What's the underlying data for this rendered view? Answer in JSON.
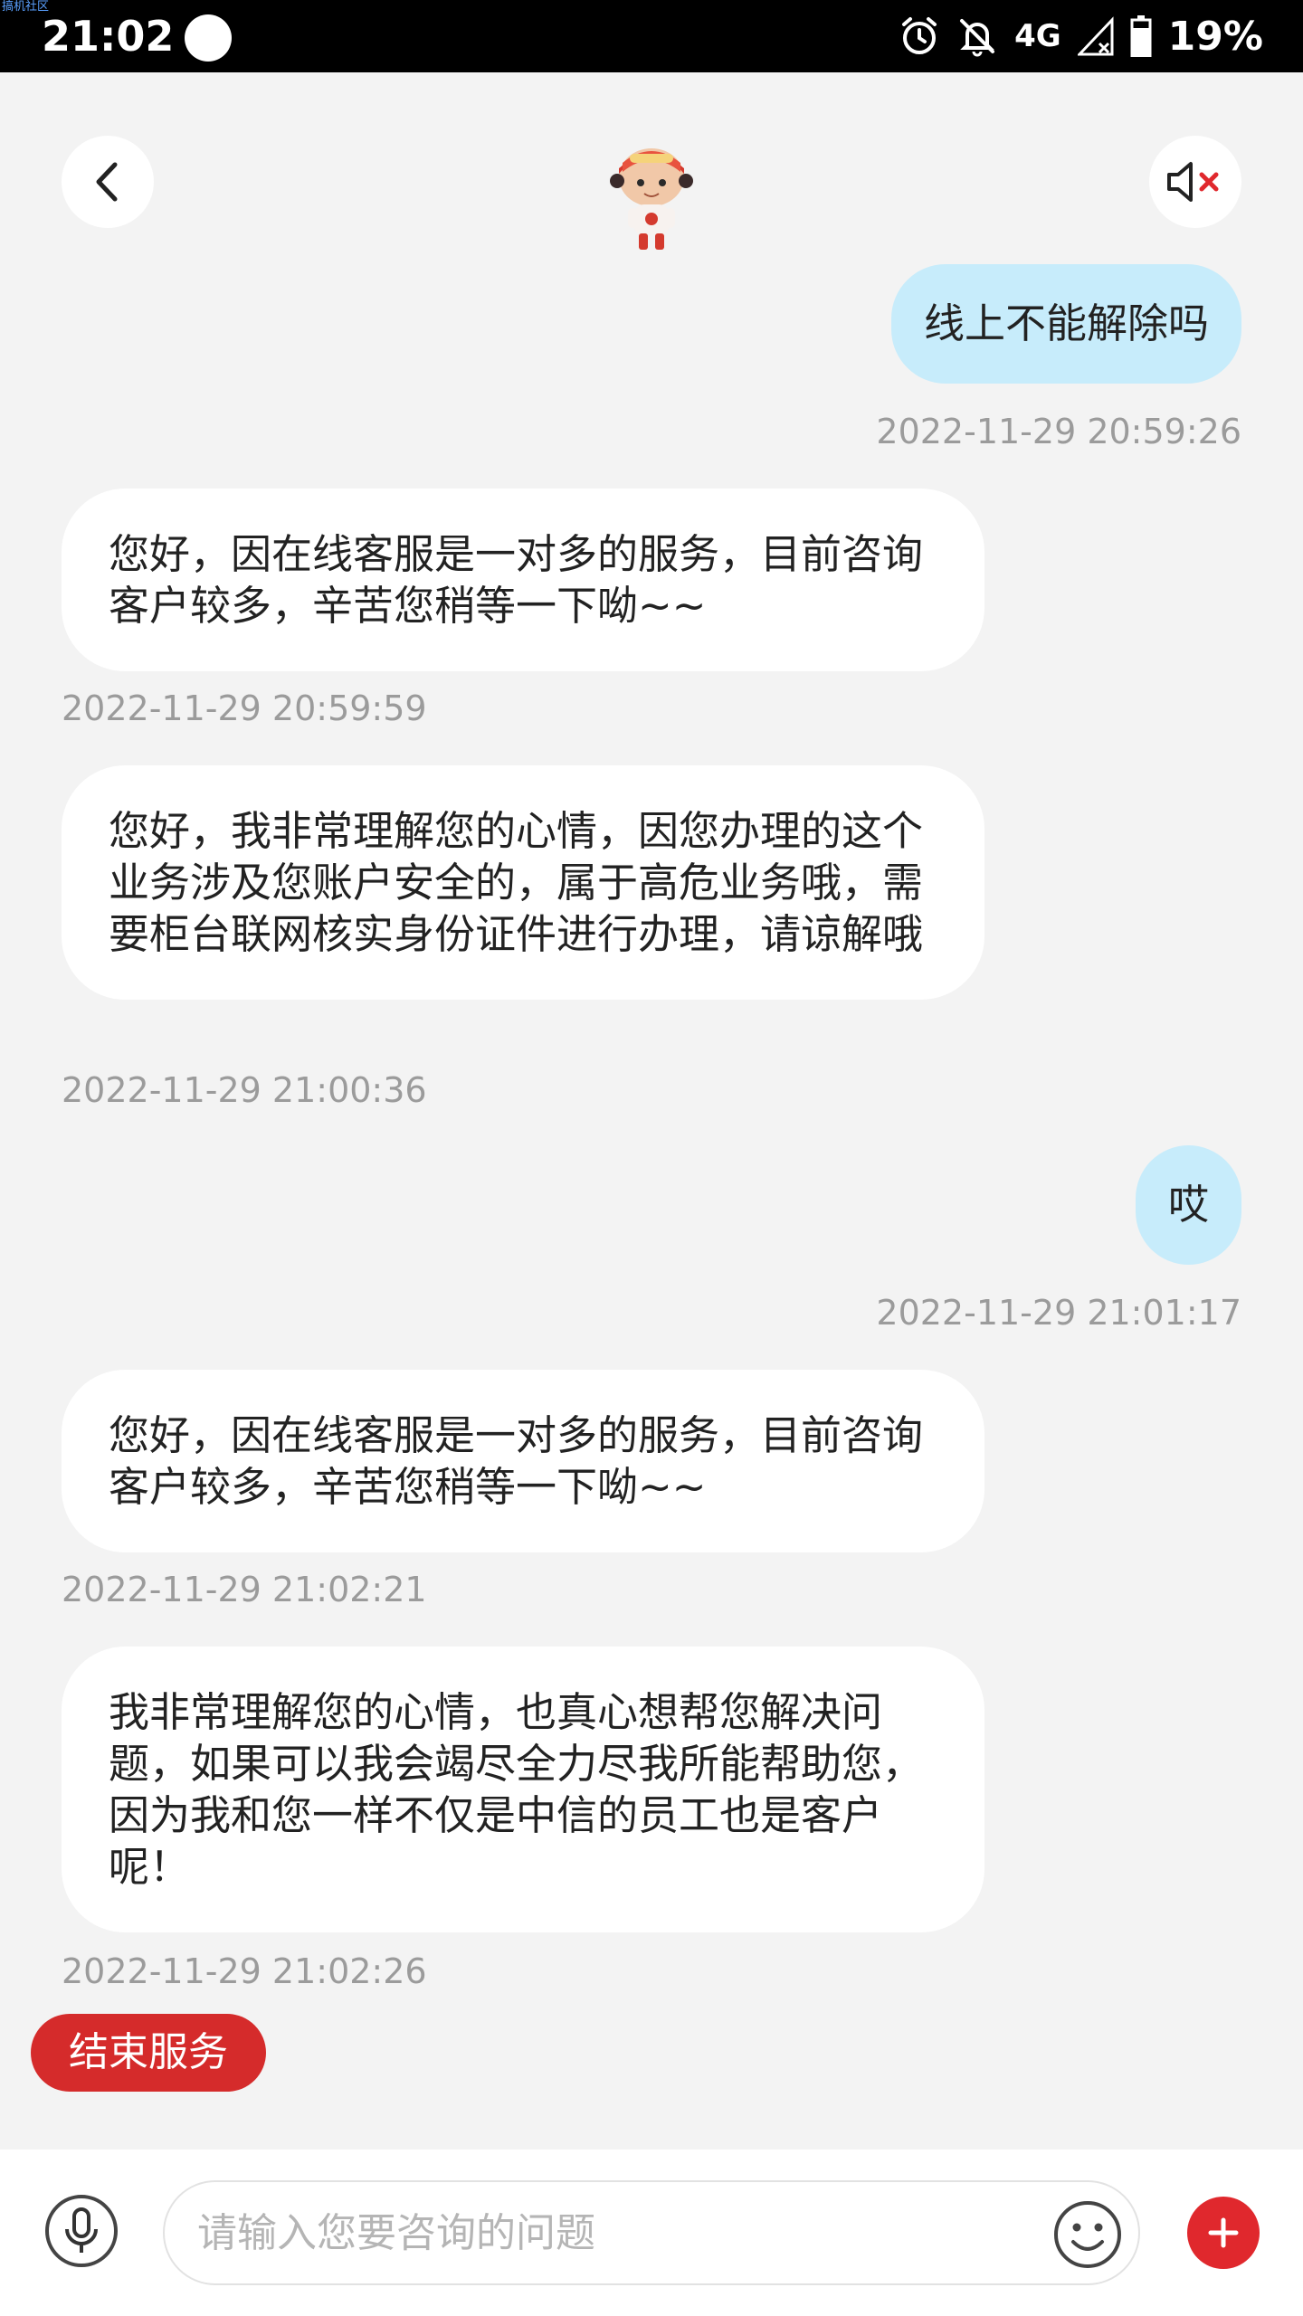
{
  "status_bar": {
    "watermark": "搞机社区",
    "time": "21:02",
    "network": "4G",
    "battery": "19%"
  },
  "header": {
    "back_icon": "chevron-left-icon",
    "mascot_icon": "mascot-avatar",
    "mute_icon": "speaker-muted-icon"
  },
  "messages": [
    {
      "side": "right",
      "text": "线上不能解除吗",
      "time": "2022-11-29 20:59:26"
    },
    {
      "side": "left",
      "text": "您好，因在线客服是一对多的服务，目前咨询客户较多，辛苦您稍等一下呦~~",
      "time": "2022-11-29 20:59:59"
    },
    {
      "side": "left",
      "text": "您好，我非常理解您的心情，因您办理的这个业务涉及您账户安全的，属于高危业务哦，需要柜台联网核实身份证件进行办理，请谅解哦",
      "time": "2022-11-29 21:00:36"
    },
    {
      "side": "right",
      "text": "哎",
      "time": "2022-11-29 21:01:17"
    },
    {
      "side": "left",
      "text": "您好，因在线客服是一对多的服务，目前咨询客户较多，辛苦您稍等一下呦~~",
      "time": "2022-11-29 21:02:21"
    },
    {
      "side": "left",
      "text": "我非常理解您的心情，也真心想帮您解决问题，如果可以我会竭尽全力尽我所能帮助您，因为我和您一样不仅是中信的员工也是客户呢！",
      "time": "2022-11-29 21:02:26"
    }
  ],
  "end_service_label": "结束服务",
  "input": {
    "placeholder": "请输入您要咨询的问题",
    "value": ""
  },
  "colors": {
    "user_bubble": "#c7ecfb",
    "agent_bubble": "#ffffff",
    "accent_red": "#d52b2b",
    "timestamp": "#9b9b9b"
  }
}
